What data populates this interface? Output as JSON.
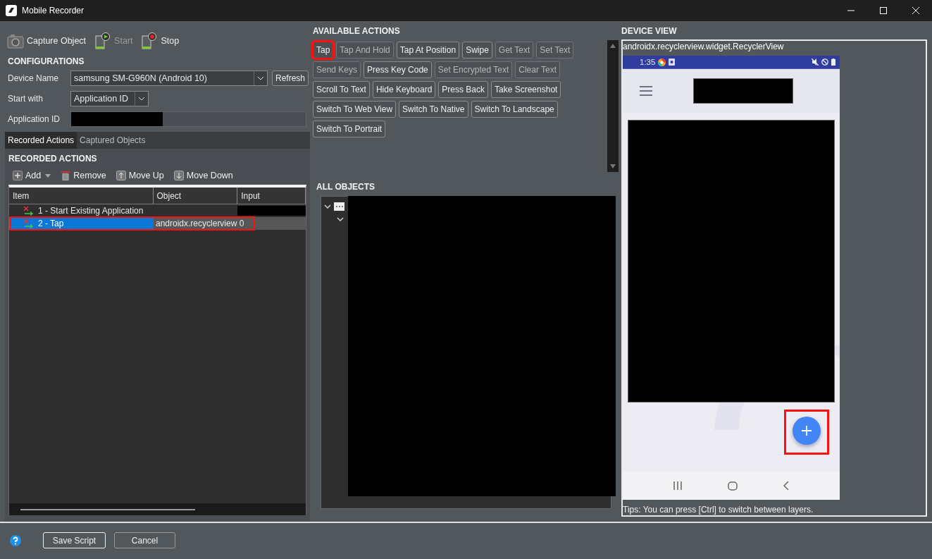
{
  "window": {
    "title": "Mobile Recorder"
  },
  "toolbar": [
    {
      "label": "Capture Object",
      "kind": "capture",
      "disabled": false
    },
    {
      "label": "Start",
      "kind": "start",
      "disabled": true
    },
    {
      "label": "Stop",
      "kind": "stop",
      "disabled": false
    }
  ],
  "configurations": {
    "title": "CONFIGURATIONS",
    "device_name": {
      "label": "Device Name",
      "value": "samsung SM-G960N (Android 10)"
    },
    "refresh_button": "Refresh",
    "start_with": {
      "label": "Start with",
      "value": "Application ID"
    },
    "application_id": {
      "label": "Application ID"
    }
  },
  "tabs": [
    {
      "label": "Recorded Actions",
      "selected": true
    },
    {
      "label": "Captured Objects",
      "selected": false
    }
  ],
  "recorded_actions": {
    "title": "RECORDED ACTIONS",
    "tools": [
      {
        "label": "Add",
        "kind": "add"
      },
      {
        "label": "Remove",
        "kind": "remove"
      },
      {
        "label": "Move Up",
        "kind": "up"
      },
      {
        "label": "Move Down",
        "kind": "down"
      }
    ],
    "columns": [
      "Item",
      "Object",
      "Input"
    ],
    "rows": [
      {
        "item": "1 - Start Existing Application",
        "selected": false,
        "highlighted": false
      },
      {
        "item": "2 - Tap",
        "object": "androidx.recyclerview 0",
        "selected": true,
        "highlighted": true
      }
    ]
  },
  "available_actions": {
    "title": "AVAILABLE ACTIONS",
    "buttons": [
      {
        "label": "Tap",
        "disabled": false,
        "highlighted": true
      },
      {
        "label": "Tap And Hold",
        "disabled": true,
        "highlighted": false
      },
      {
        "label": "Tap At Position",
        "disabled": false,
        "highlighted": false
      },
      {
        "label": "Swipe",
        "disabled": false,
        "highlighted": false
      },
      {
        "label": "Get Text",
        "disabled": true,
        "highlighted": false
      },
      {
        "label": "Set Text",
        "disabled": true,
        "highlighted": false
      },
      {
        "label": "Send Keys",
        "disabled": true,
        "highlighted": false
      },
      {
        "label": "Press Key Code",
        "disabled": false,
        "highlighted": false
      },
      {
        "label": "Set Encrypted Text",
        "disabled": true,
        "highlighted": false
      },
      {
        "label": "Clear Text",
        "disabled": true,
        "highlighted": false
      },
      {
        "label": "Scroll To Text",
        "disabled": false,
        "highlighted": false
      },
      {
        "label": "Hide Keyboard",
        "disabled": false,
        "highlighted": false
      },
      {
        "label": "Press Back",
        "disabled": false,
        "highlighted": false
      },
      {
        "label": "Take Screenshot",
        "disabled": false,
        "highlighted": false
      },
      {
        "label": "Switch To Web View",
        "disabled": false,
        "highlighted": false
      },
      {
        "label": "Switch To Native",
        "disabled": false,
        "highlighted": false
      },
      {
        "label": "Switch To Landscape",
        "disabled": false,
        "highlighted": false
      },
      {
        "label": "Switch To Portrait",
        "disabled": false,
        "highlighted": false
      }
    ]
  },
  "all_objects": {
    "title": "ALL OBJECTS"
  },
  "device_view": {
    "title": "DEVICE VIEW",
    "element": "androidx.recyclerview.widget.RecyclerView",
    "phone": {
      "time": "1:35",
      "fab_highlighted": true
    },
    "tip": "Tips: You can press [Ctrl] to switch between layers."
  },
  "footer": {
    "buttons": [
      {
        "label": "Save Script",
        "kind": "default"
      },
      {
        "label": "Cancel",
        "kind": "normal"
      }
    ]
  }
}
